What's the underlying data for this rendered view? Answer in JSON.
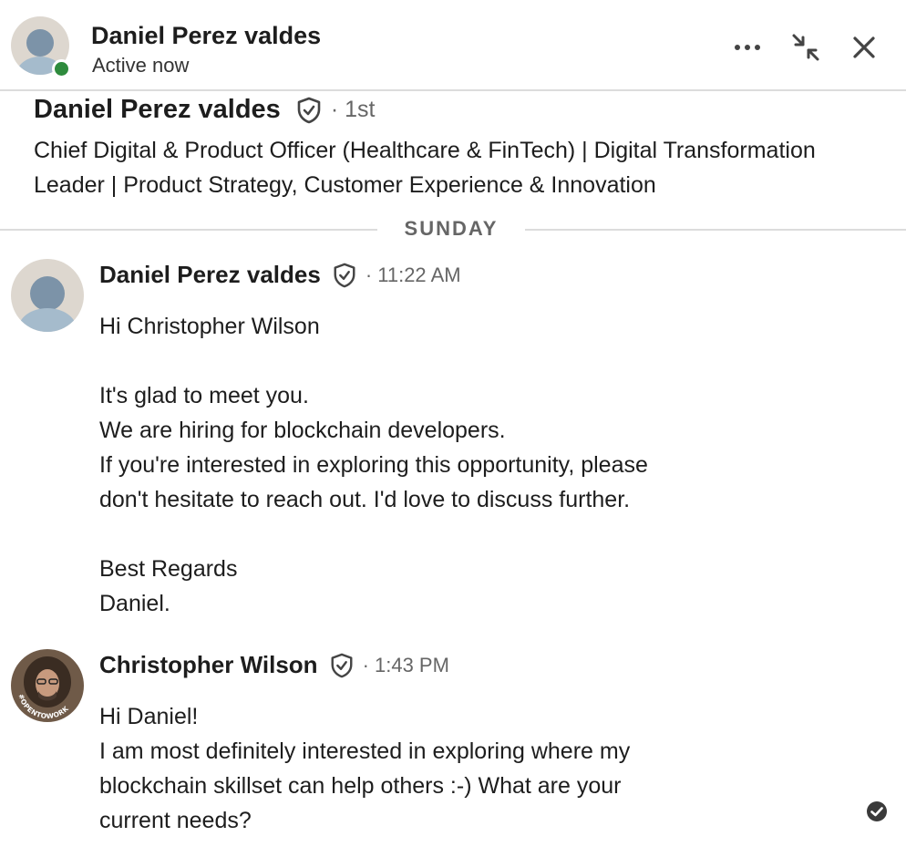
{
  "header": {
    "name": "Daniel Perez valdes",
    "status": "Active now",
    "more_icon": "more-horizontal-icon",
    "minimize_icon": "minimize-icon",
    "close_icon": "close-icon",
    "presence_color": "#2e8b3d"
  },
  "profile": {
    "name": "Daniel Perez valdes",
    "verified_icon": "verified-shield-icon",
    "degree": "· 1st",
    "headline": "Chief Digital & Product Officer (Healthcare & FinTech) | Digital Transformation Leader | Product Strategy, Customer Experience & Innovation"
  },
  "day_divider": {
    "label": "SUNDAY"
  },
  "messages": [
    {
      "author": "Daniel Perez valdes",
      "time": "· 11:22 AM",
      "lines": [
        "Hi Christopher Wilson",
        "",
        "It's glad to meet you.",
        "We are hiring for blockchain developers.",
        "If you're interested in exploring this opportunity, please",
        "don't hesitate to reach out. I'd love to discuss further.",
        "",
        "Best Regards",
        "Daniel."
      ]
    },
    {
      "author": "Christopher Wilson",
      "time": "· 1:43 PM",
      "avatar_badge": "#OPENTOWORK",
      "lines": [
        "Hi Daniel!",
        "I am most definitely interested in exploring where my",
        "blockchain skillset can help others :-) What are your",
        "current needs?"
      ]
    }
  ],
  "read_receipt_icon": "read-check-icon"
}
